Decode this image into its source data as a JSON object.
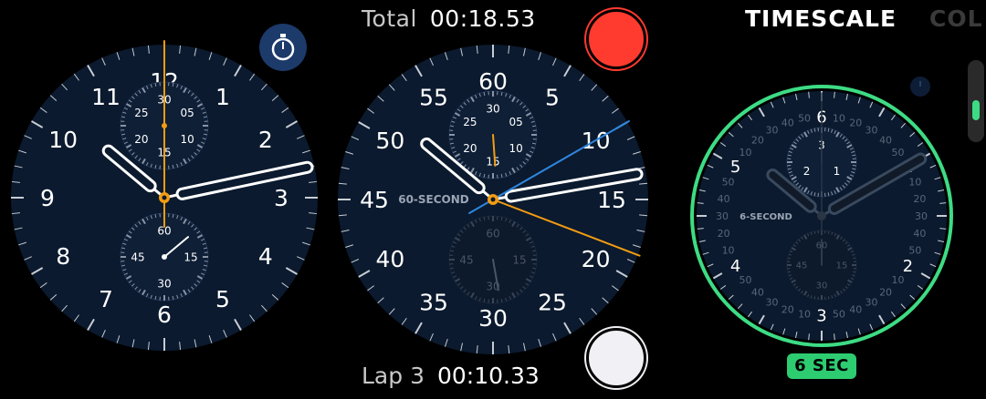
{
  "left_dial": {
    "hour_numerals": [
      "12",
      "1",
      "2",
      "3",
      "4",
      "5",
      "6",
      "7",
      "8",
      "9",
      "10",
      "11"
    ],
    "sub_top_numerals": [
      "30",
      "05",
      "10",
      "15",
      "20",
      "25"
    ],
    "sub_bottom_numerals": [
      "60",
      "15",
      "30",
      "45"
    ]
  },
  "middle_dial": {
    "total_label": "Total",
    "total_value": "00:18.53",
    "lap_label": "Lap 3",
    "lap_value": "00:10.33",
    "second_numerals": [
      "60",
      "5",
      "10",
      "15",
      "20",
      "25",
      "30",
      "35",
      "40",
      "45",
      "50",
      "55"
    ],
    "sub_top_numerals": [
      "30",
      "05",
      "10",
      "15",
      "20",
      "25"
    ],
    "sub_bottom_numerals": [
      "60",
      "15",
      "30",
      "45"
    ],
    "dial_label": "60-SECOND"
  },
  "right_dial": {
    "tab_timescale": "TIMESCALE",
    "tab_color": "COL",
    "main_numerals": [
      "6",
      "1",
      "2",
      "3",
      "4",
      "5"
    ],
    "sub_top_numerals": [
      "3",
      "1",
      "2"
    ],
    "sub_bottom_numerals": [
      "60",
      "15",
      "30",
      "45"
    ],
    "dial_label": "6-SECOND",
    "badge": "6 SEC"
  },
  "colors": {
    "accent_orange": "#f39c12",
    "accent_blue": "#2e86de",
    "record_red": "#ff3b30",
    "ring_green": "#3ddc84",
    "dial_bg": "#0b1a2e"
  }
}
